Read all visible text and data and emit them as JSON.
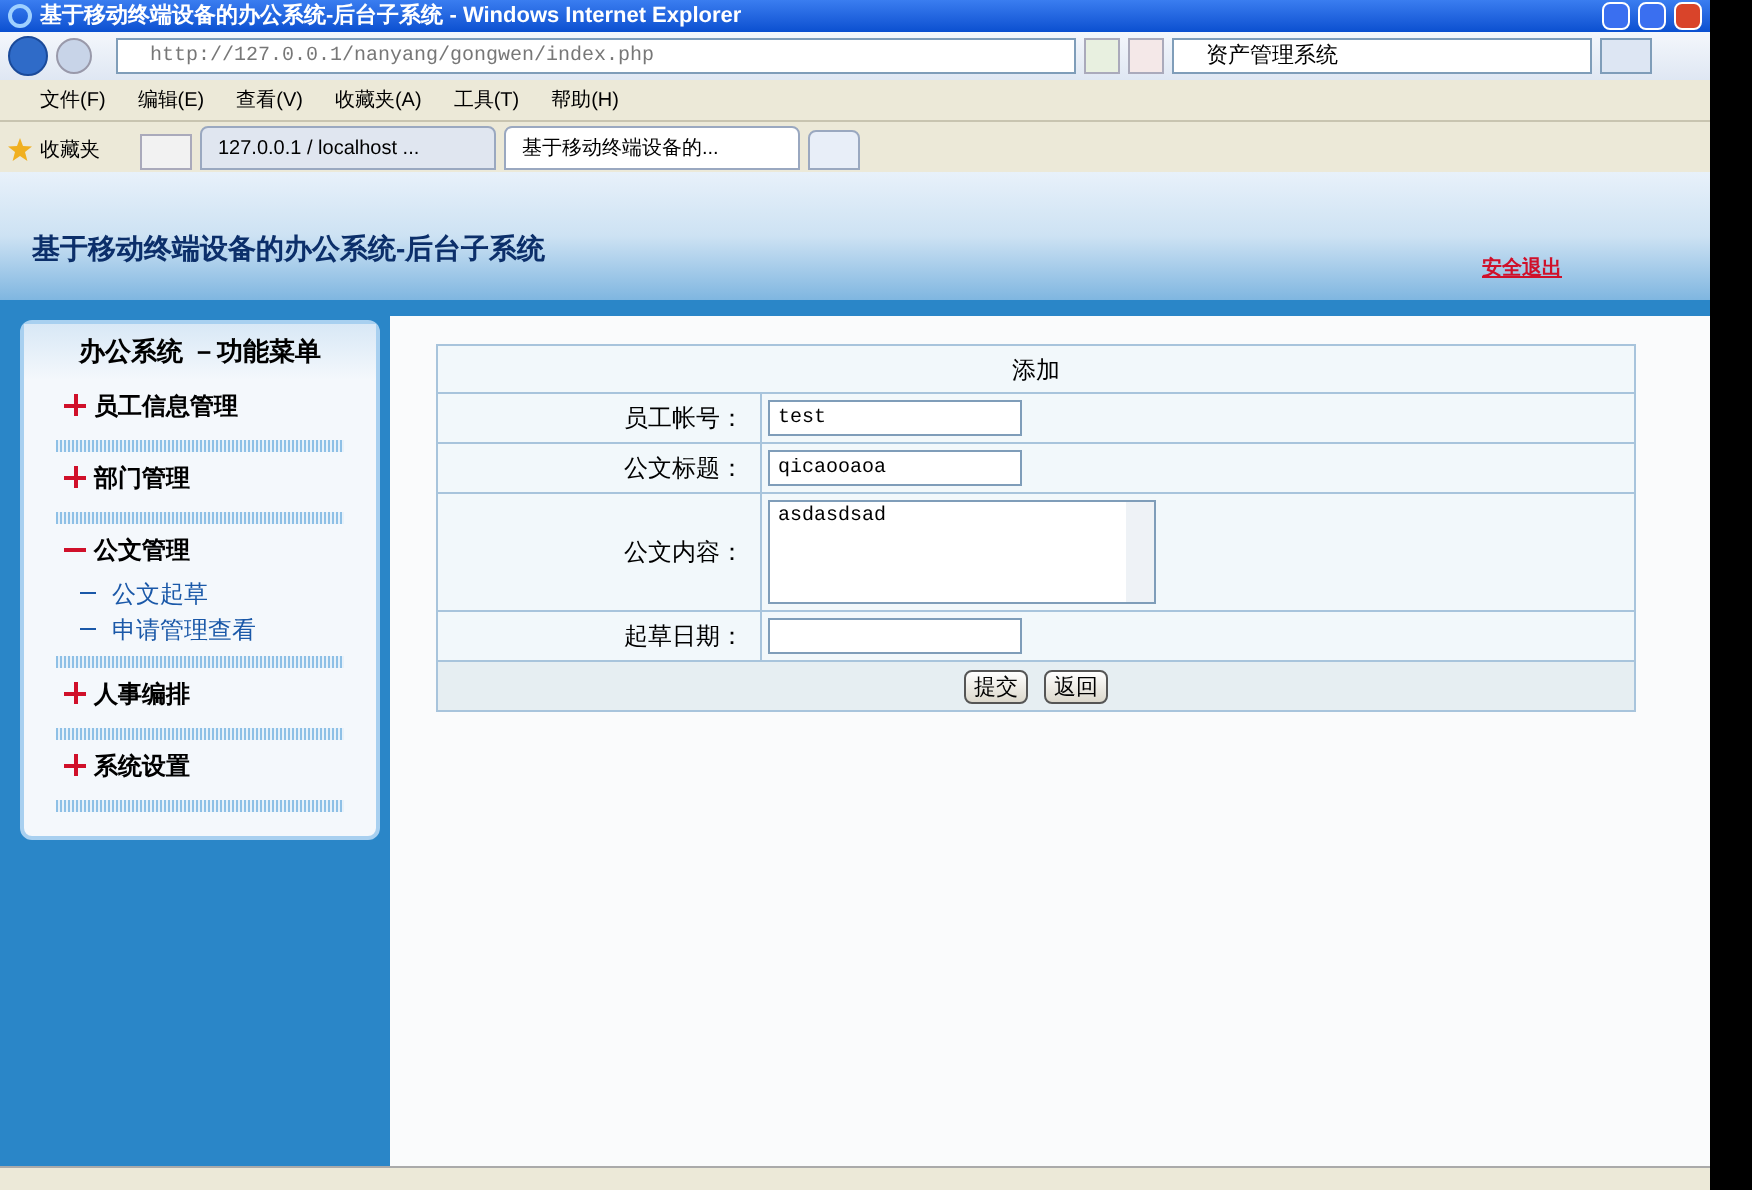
{
  "window": {
    "title": "基于移动终端设备的办公系统-后台子系统 - Windows Internet Explorer"
  },
  "address_bar": {
    "url": "http://127.0.0.1/nanyang/gongwen/index.php",
    "search": "资产管理系统"
  },
  "menu_bar": [
    "文件(F)",
    "编辑(E)",
    "查看(V)",
    "收藏夹(A)",
    "工具(T)",
    "帮助(H)"
  ],
  "favorites": {
    "label": "收藏夹"
  },
  "tabs": [
    {
      "label": "127.0.0.1 / localhost ...",
      "selected": false
    },
    {
      "label": "基于移动终端设备的...",
      "selected": true
    }
  ],
  "header": {
    "title": "基于移动终端设备的办公系统-后台子系统",
    "logout": "安全退出"
  },
  "sidebar": {
    "title": "办公系统 －功能菜单",
    "items": [
      {
        "label": "员工信息管理",
        "expanded": false
      },
      {
        "label": "部门管理",
        "expanded": false
      },
      {
        "label": "公文管理",
        "expanded": true,
        "children": [
          {
            "label": "公文起草"
          },
          {
            "label": "申请管理查看"
          }
        ]
      },
      {
        "label": "人事编排",
        "expanded": false
      },
      {
        "label": "系统设置",
        "expanded": false
      }
    ]
  },
  "form": {
    "title": "添加",
    "fields": [
      {
        "kind": "input",
        "label": "员工帐号：",
        "value": "test"
      },
      {
        "kind": "input",
        "label": "公文标题：",
        "value": "qicaooaoa"
      },
      {
        "kind": "textarea",
        "label": "公文内容：",
        "value": "asdasdsad"
      },
      {
        "kind": "input",
        "label": "起草日期："
      }
    ],
    "buttons": [
      "提交",
      "返回"
    ]
  }
}
